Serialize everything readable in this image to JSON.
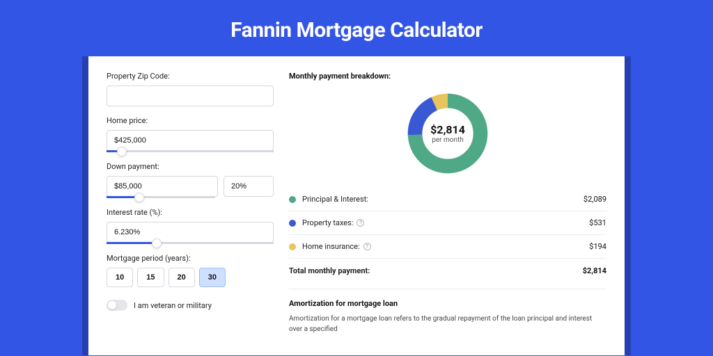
{
  "page_title": "Fannin Mortgage Calculator",
  "form": {
    "zip": {
      "label": "Property Zip Code:",
      "value": ""
    },
    "home_price": {
      "label": "Home price:",
      "value": "$425,000",
      "slider_pct": 9
    },
    "down_payment": {
      "label": "Down payment:",
      "amount": "$85,000",
      "pct": "20%",
      "slider_pct": 20
    },
    "interest_rate": {
      "label": "Interest rate (%):",
      "value": "6.230%",
      "slider_pct": 30
    },
    "period": {
      "label": "Mortgage period (years):",
      "options": [
        "10",
        "15",
        "20",
        "30"
      ],
      "selected": "30"
    },
    "veteran": {
      "label": "I am veteran or military",
      "checked": false
    }
  },
  "breakdown": {
    "title": "Monthly payment breakdown:",
    "center_value": "$2,814",
    "center_label": "per month",
    "items": [
      {
        "label": "Principal & Interest:",
        "value": "$2,089",
        "color": "#4fa886",
        "help": false
      },
      {
        "label": "Property taxes:",
        "value": "$531",
        "color": "#3958d3",
        "help": true
      },
      {
        "label": "Home insurance:",
        "value": "$194",
        "color": "#e9c35b",
        "help": true
      }
    ],
    "total_label": "Total monthly payment:",
    "total_value": "$2,814"
  },
  "chart_data": {
    "type": "pie",
    "title": "Monthly payment breakdown",
    "series": [
      {
        "name": "Principal & Interest",
        "value": 2089,
        "color": "#4fa886"
      },
      {
        "name": "Property taxes",
        "value": 531,
        "color": "#3958d3"
      },
      {
        "name": "Home insurance",
        "value": 194,
        "color": "#e9c35b"
      }
    ],
    "total": 2814,
    "center_label": "per month"
  },
  "amortization": {
    "title": "Amortization for mortgage loan",
    "text": "Amortization for a mortgage loan refers to the gradual repayment of the loan principal and interest over a specified"
  }
}
